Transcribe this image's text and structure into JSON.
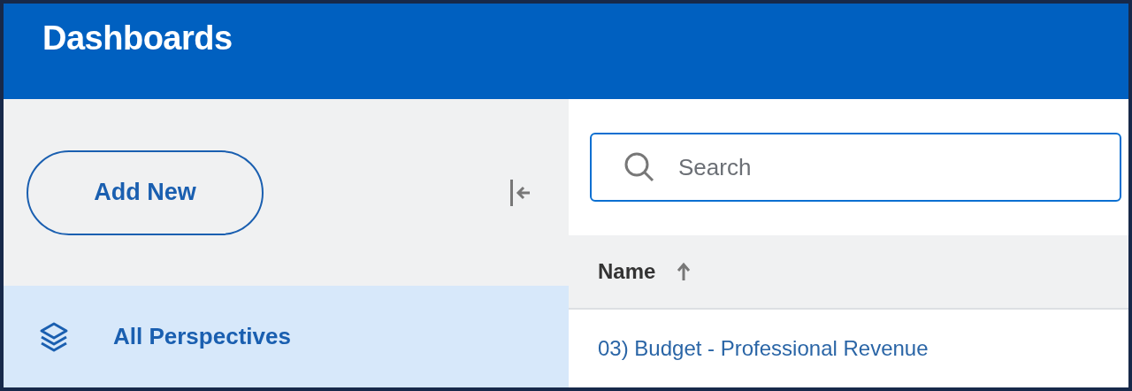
{
  "header": {
    "title": "Dashboards"
  },
  "sidebar": {
    "add_button": "Add New",
    "items": [
      {
        "label": "All Perspectives",
        "selected": true
      }
    ]
  },
  "search": {
    "placeholder": "Search"
  },
  "table": {
    "columns": [
      {
        "label": "Name",
        "sorted_ascending": true
      }
    ],
    "rows": [
      {
        "name": "03) Budget - Professional Revenue"
      }
    ]
  }
}
